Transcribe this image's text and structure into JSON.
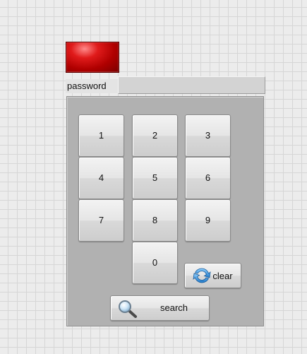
{
  "password": {
    "label": "password",
    "value": ""
  },
  "keypad": {
    "digits": [
      "1",
      "2",
      "3",
      "4",
      "5",
      "6",
      "7",
      "8",
      "9",
      "0"
    ],
    "clear_label": "clear",
    "search_label": "search",
    "icons": {
      "clear": "refresh-icon",
      "search": "magnifier-icon"
    }
  },
  "colors": {
    "indicator": "#c00000",
    "panel": "#b1b1b1"
  }
}
